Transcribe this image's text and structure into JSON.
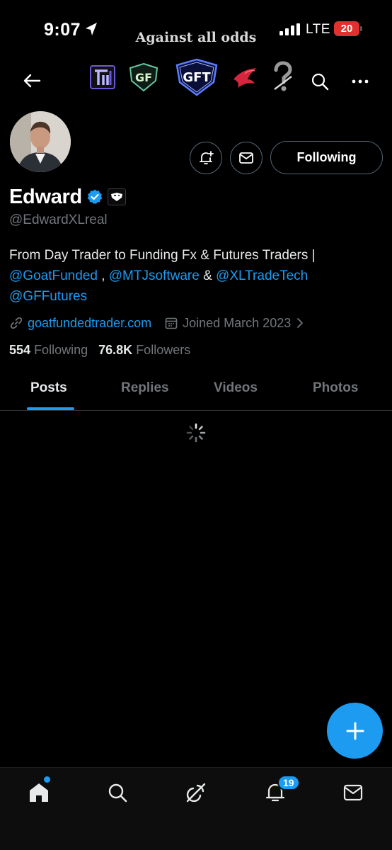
{
  "status_bar": {
    "time": "9:07",
    "banner": "Against all odds",
    "network": "LTE",
    "battery": "20"
  },
  "header": {
    "logos": [
      "TI",
      "GF",
      "GFT",
      "bird",
      "?"
    ]
  },
  "profile": {
    "name": "Edward",
    "handle": "@EdwardXLreal",
    "follow_state": "Following",
    "bio_text_1": "From Day Trader to Funding Fx & Futures Traders |",
    "bio_mention_1": "@GoatFunded",
    "bio_sep_1": " , ",
    "bio_mention_2": "@MTJsoftware",
    "bio_sep_2": " & ",
    "bio_mention_3": "@XLTradeTech",
    "bio_mention_4": "@GFFutures",
    "website": "goatfundedtrader.com",
    "joined": "Joined March 2023",
    "following_count": "554",
    "following_label": "Following",
    "followers_count": "76.8K",
    "followers_label": "Followers"
  },
  "tabs": [
    {
      "label": "Posts",
      "active": true
    },
    {
      "label": "Replies",
      "active": false
    },
    {
      "label": "Videos",
      "active": false
    },
    {
      "label": "Photos",
      "active": false
    }
  ],
  "bottom_nav": {
    "items": [
      "home-icon",
      "search-icon",
      "grok-icon",
      "notifications-icon",
      "messages-icon"
    ],
    "notification_count": "19"
  },
  "colors": {
    "accent": "#1d9bf0",
    "background": "#000000",
    "muted": "#71767b",
    "battery_low": "#e0312f"
  }
}
